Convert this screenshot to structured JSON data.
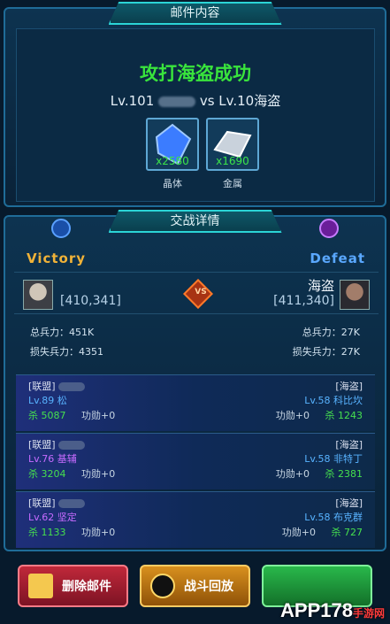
{
  "mail_panel": {
    "title": "邮件内容",
    "result_title": "攻打海盗成功",
    "attacker_level": "Lv.101",
    "vs_text": "vs Lv.10海盗",
    "loot": [
      {
        "name": "晶体",
        "count": "x2580",
        "icon": "crystal-icon"
      },
      {
        "name": "金属",
        "count": "x1690",
        "icon": "metal-icon"
      }
    ]
  },
  "detail_panel": {
    "title": "交战详情",
    "left_result": "Victory",
    "right_result": "Defeat",
    "left": {
      "coord": "[410,341]",
      "total": "总兵力：451K",
      "lost": "损失兵力：4351"
    },
    "right": {
      "name": "海盗",
      "coord": "[411,340]",
      "total": "总兵力：27K",
      "lost": "损失兵力：27K"
    },
    "vs": "VS",
    "rows": [
      {
        "l_alliance": "[联盟]",
        "l_level": "Lv.89 松",
        "l_kills": "杀 5087",
        "l_merit": "功勋+0",
        "r_alliance": "[海盗]",
        "r_level": "Lv.58 科比坎",
        "r_merit": "功勋+0",
        "r_kills": "杀 1243",
        "l_color": "blue"
      },
      {
        "l_alliance": "[联盟]",
        "l_level": "Lv.76 基辅",
        "l_kills": "杀 3204",
        "l_merit": "功勋+0",
        "r_alliance": "[海盗]",
        "r_level": "Lv.58 非特丁",
        "r_merit": "功勋+0",
        "r_kills": "杀 2381",
        "l_color": "purple"
      },
      {
        "l_alliance": "[联盟]",
        "l_level": "Lv.62 坚定",
        "l_kills": "杀 1133",
        "l_merit": "功勋+0",
        "r_alliance": "[海盗]",
        "r_level": "Lv.58 布克群",
        "r_merit": "功勋+0",
        "r_kills": "杀 727",
        "l_color": "purple"
      }
    ]
  },
  "buttons": {
    "delete": "删除邮件",
    "replay": "战斗回放"
  },
  "watermark": {
    "main": "APP178",
    "sub": "手游网"
  }
}
